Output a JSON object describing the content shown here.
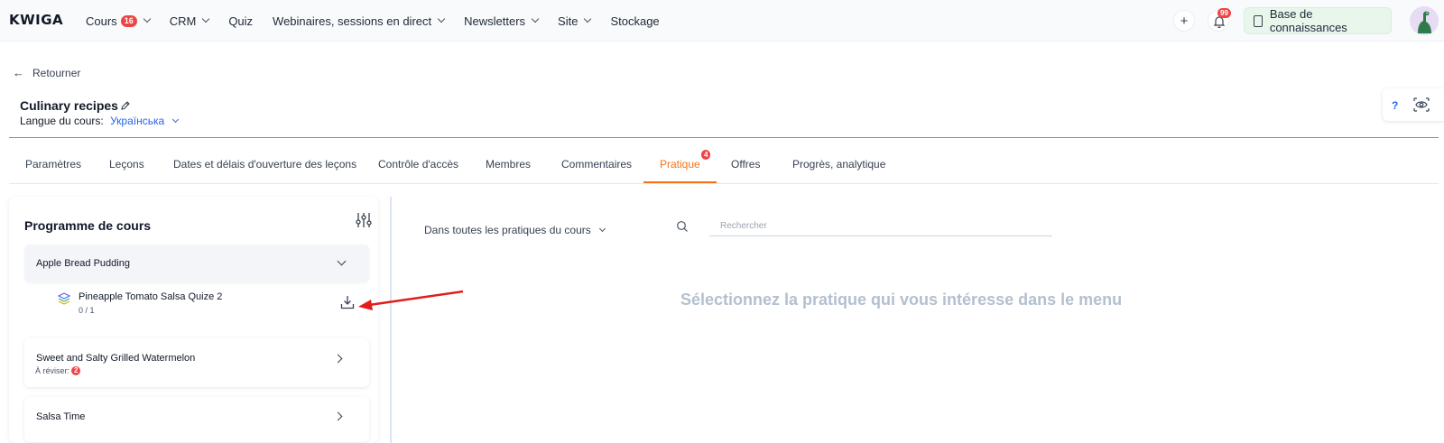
{
  "header": {
    "logo": "KWIGA",
    "nav": [
      {
        "label": "Cours",
        "badge": "16",
        "dropdown": true
      },
      {
        "label": "CRM",
        "dropdown": true
      },
      {
        "label": "Quiz",
        "dropdown": false
      },
      {
        "label": "Webinaires, sessions en direct",
        "dropdown": true
      },
      {
        "label": "Newsletters",
        "dropdown": true
      },
      {
        "label": "Site",
        "dropdown": true
      },
      {
        "label": "Stockage",
        "dropdown": false
      }
    ],
    "plus_icon": "+",
    "notifications_badge": "99",
    "knowledge_base_label": "Base de connaissances"
  },
  "back_label": "Retourner",
  "course": {
    "title": "Culinary recipes",
    "language_label": "Langue du cours:",
    "language_value": "Українська"
  },
  "help_label": "?",
  "tabs": [
    {
      "label": "Paramètres",
      "active": false
    },
    {
      "label": "Leçons",
      "active": false
    },
    {
      "label": "Dates et délais d'ouverture des leçons",
      "active": false
    },
    {
      "label": "Contrôle d'accès",
      "active": false
    },
    {
      "label": "Membres",
      "active": false
    },
    {
      "label": "Commentaires",
      "active": false
    },
    {
      "label": "Pratique",
      "active": true,
      "badge": "4"
    },
    {
      "label": "Offres",
      "active": false
    },
    {
      "label": "Progrès, analytique",
      "active": false
    }
  ],
  "program": {
    "title": "Programme de cours",
    "sections": [
      {
        "name": "Apple Bread Pudding",
        "expanded": true,
        "lessons": [
          {
            "name": "Pineapple Tomato Salsa Quize 2",
            "progress": "0 / 1"
          }
        ]
      },
      {
        "name": "Sweet and Salty Grilled Watermelon",
        "expanded": false,
        "review_label": "À réviser:",
        "review_count": "2"
      },
      {
        "name": "Salsa Time",
        "expanded": false
      }
    ]
  },
  "practice": {
    "filter_label": "Dans toutes les pratiques du cours",
    "search_placeholder": "Rechercher",
    "empty_message": "Sélectionnez la pratique qui vous intéresse dans le menu"
  },
  "colors": {
    "accent": "#f97316",
    "link": "#2563eb",
    "badge": "#ef4444",
    "annotation": "#e11d1d"
  }
}
